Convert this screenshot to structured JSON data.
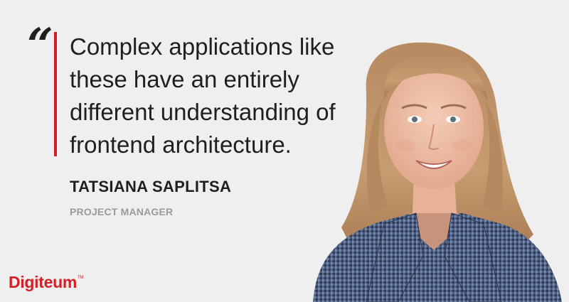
{
  "quote": {
    "mark": "“",
    "lines": [
      "Complex applications like",
      "these have an entirely",
      "different understanding of",
      "frontend architecture."
    ]
  },
  "person": {
    "name": "TATSIANA SAPLITSA",
    "role": "PROJECT MANAGER"
  },
  "logo": {
    "text": "Digiteum",
    "trademark": "TM"
  },
  "colors": {
    "background": "#efefef",
    "accent": "#d32027",
    "text": "#1f1f1f",
    "muted": "#9a9a9a"
  }
}
